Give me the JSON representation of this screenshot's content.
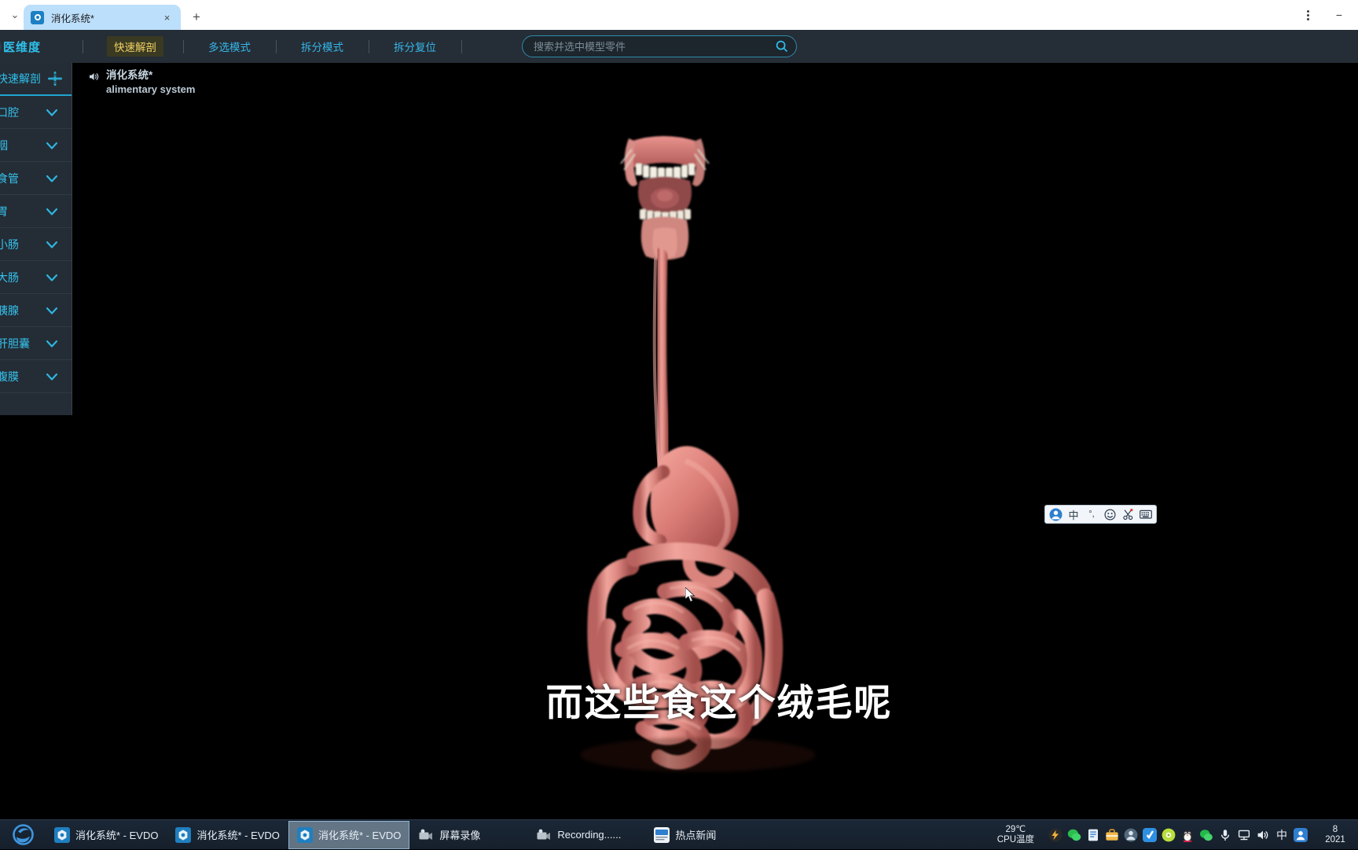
{
  "browser": {
    "tab": {
      "title": "消化系统*",
      "favicon_icon": "evdo-logo-icon",
      "close_icon": "×"
    },
    "new_tab_icon": "+",
    "menu_icon": "kebab-menu-icon",
    "minimize_icon": "−"
  },
  "toolbar": {
    "brand": "医维度",
    "items": [
      {
        "label": "快速解剖",
        "active": true
      },
      {
        "label": "多选模式",
        "active": false
      },
      {
        "label": "拆分模式",
        "active": false
      },
      {
        "label": "拆分复位",
        "active": false
      }
    ],
    "search": {
      "placeholder": "搜索并选中模型零件",
      "value": "",
      "icon": "search-icon"
    },
    "accent": "#35b6e8",
    "active_color": "#f0d264"
  },
  "sidebar": {
    "header": {
      "title": "快速解剖",
      "icon": "move-cross-icon"
    },
    "items": [
      {
        "label": "口腔",
        "chevron": "chevron-down-icon"
      },
      {
        "label": "咽",
        "chevron": "chevron-down-icon"
      },
      {
        "label": "食管",
        "chevron": "chevron-down-icon"
      },
      {
        "label": "胃",
        "chevron": "chevron-down-icon"
      },
      {
        "label": "小肠",
        "chevron": "chevron-down-icon"
      },
      {
        "label": "大肠",
        "chevron": "chevron-down-icon"
      },
      {
        "label": "胰腺",
        "chevron": "chevron-down-icon"
      },
      {
        "label": "肝胆囊",
        "chevron": "chevron-down-icon"
      },
      {
        "label": "腹膜",
        "chevron": "chevron-down-icon"
      }
    ]
  },
  "viewport": {
    "model_label": {
      "speaker_icon": "speaker-icon",
      "name_cn": "消化系统*",
      "name_en": "alimentary system"
    },
    "caption": "而这些食这个绒毛呢",
    "background": "#000000",
    "model_color": "#e08b85"
  },
  "ime_bar": {
    "buttons": [
      {
        "icon": "ime-avatar-icon",
        "label": ""
      },
      {
        "icon": "ime-chinese-icon",
        "label": "中"
      },
      {
        "icon": "ime-punctuation-icon",
        "label": "°,"
      },
      {
        "icon": "ime-emoji-icon",
        "label": "☺"
      },
      {
        "icon": "ime-scissors-icon",
        "label": "✂"
      },
      {
        "icon": "ime-keyboard-icon",
        "label": "⌨"
      }
    ]
  },
  "taskbar": {
    "start_icon": "edge-browser-icon",
    "items": [
      {
        "label": "消化系统* - EVDO",
        "icon": "evdo-logo-icon",
        "active": false
      },
      {
        "label": "消化系统* - EVDO",
        "icon": "evdo-logo-icon",
        "active": false
      },
      {
        "label": "消化系统* - EVDO",
        "icon": "evdo-logo-icon",
        "active": true
      },
      {
        "label": "屏幕录像",
        "icon": "camcorder-icon",
        "active": false
      },
      {
        "label": "Recording......",
        "icon": "camcorder-icon",
        "active": false
      },
      {
        "label": "热点新闻",
        "icon": "hot-news-icon",
        "active": false
      }
    ],
    "cpu_temp": {
      "value": "29℃",
      "label": "CPU温度"
    },
    "tray_icons": [
      "thunder-download-icon",
      "wechat-icon",
      "doc-share-icon",
      "toolbox-icon",
      "user-app-icon",
      "sync-icon",
      "disc-icon",
      "qq-penguin-icon",
      "wechat-work-icon",
      "microphone-icon",
      "network-icon",
      "volume-icon"
    ],
    "ime_indicator": "中",
    "account_icon": "user-account-icon",
    "clock": {
      "time": "8",
      "date": "2021"
    }
  }
}
